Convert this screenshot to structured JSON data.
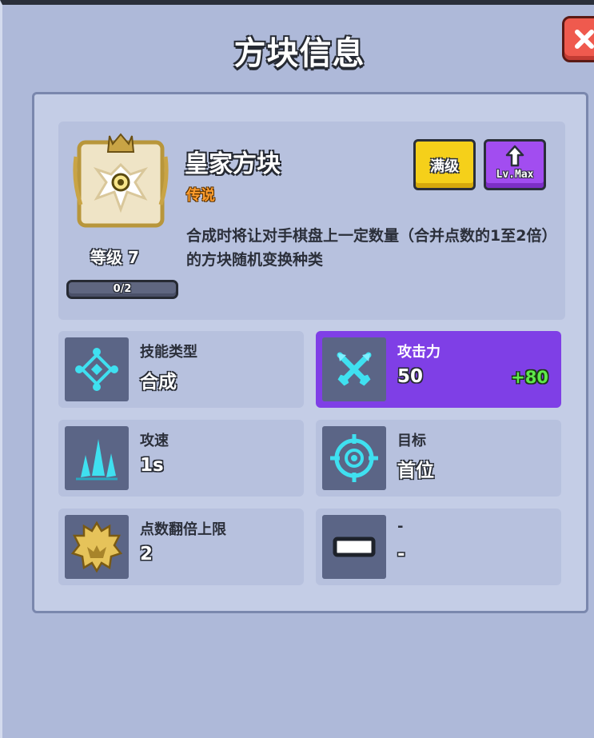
{
  "window": {
    "title": "方块信息"
  },
  "block": {
    "name": "皇家方块",
    "rarity": "传说",
    "level_label": "等级 7",
    "progress_text": "0/2",
    "progress": 0,
    "description": "合成时将让对手棋盘上一定数量（合并点数的1至2倍）的方块随机变换种类",
    "icon": "royal-crest-icon"
  },
  "buttons": {
    "max_level": "满级",
    "lv_max": "Lv.Max"
  },
  "stats": [
    {
      "label": "技能类型",
      "value": "合成",
      "icon": "diamond-nodes-icon"
    },
    {
      "label": "攻击力",
      "value": "50",
      "bonus": "+80",
      "icon": "crossed-swords-icon"
    },
    {
      "label": "攻速",
      "value": "1s",
      "icon": "arrows-icon"
    },
    {
      "label": "目标",
      "value": "首位",
      "icon": "crosshair-icon"
    },
    {
      "label": "点数翻倍上限",
      "value": "2",
      "icon": "gold-crest-icon"
    },
    {
      "label": "-",
      "value": "-",
      "icon": "dash-icon"
    }
  ],
  "colors": {
    "highlight": "#7f3fe6",
    "bonus": "#5ee94a",
    "rarity": "#ff9d2e"
  }
}
